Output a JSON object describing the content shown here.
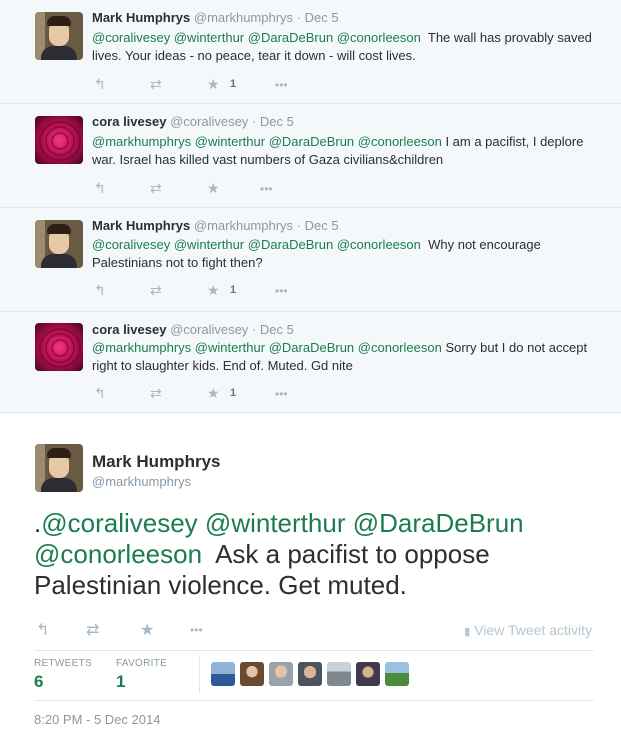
{
  "replies": [
    {
      "name": "Mark Humphrys",
      "screen_name": "@markhumphrys",
      "date": "Dec 5",
      "mentions": [
        "@coralivesey",
        "@winterthur",
        "@DaraDeBrun",
        "@conorleeson"
      ],
      "text": "The wall has provably saved lives. Your ideas - no peace, tear it down - will cost lives.",
      "favorite_count": "1",
      "avatar": "man-portrait"
    },
    {
      "name": "cora livesey",
      "screen_name": "@coralivesey",
      "date": "Dec 5",
      "mentions": [
        "@markhumphrys",
        "@winterthur",
        "@DaraDeBrun",
        "@conorleeson"
      ],
      "text": "I am a pacifist, I deplore war. Israel has killed vast numbers of Gaza civilians&children",
      "favorite_count": "",
      "avatar": "pink-rose"
    },
    {
      "name": "Mark Humphrys",
      "screen_name": "@markhumphrys",
      "date": "Dec 5",
      "mentions": [
        "@coralivesey",
        "@winterthur",
        "@DaraDeBrun",
        "@conorleeson"
      ],
      "text": "Why not encourage Palestinians not to fight then?",
      "favorite_count": "1",
      "avatar": "man-portrait"
    },
    {
      "name": "cora livesey",
      "screen_name": "@coralivesey",
      "date": "Dec 5",
      "mentions": [
        "@markhumphrys",
        "@winterthur",
        "@DaraDeBrun",
        "@conorleeson"
      ],
      "text": "Sorry but I do not accept right to slaughter kids. End of. Muted. Gd nite",
      "favorite_count": "1",
      "avatar": "pink-rose"
    }
  ],
  "main_tweet": {
    "name": "Mark Humphrys",
    "screen_name": "@markhumphrys",
    "prefix": ".",
    "mentions": [
      "@coralivesey",
      "@winterthur",
      "@DaraDeBrun",
      "@conorleeson"
    ],
    "text": "Ask a pacifist to oppose Palestinian violence. Get muted.",
    "view_activity": "View Tweet activity",
    "stats": {
      "retweets_label": "RETWEETS",
      "retweets": "6",
      "favorite_label": "FAVORITE",
      "favorites": "1"
    },
    "timestamp": "8:20 PM - 5 Dec 2014"
  },
  "icons": {
    "reply": "↰",
    "retweet": "⇄",
    "favorite": "★",
    "more": "•••",
    "activity": "▮"
  },
  "colors": {
    "mention": "#1b7d4f",
    "muted": "#8899a6",
    "reply_bg": "#f5f8fa"
  },
  "favoriter_avatars": [
    "flag-avatar",
    "woman-avatar",
    "man-avatar-1",
    "man-avatar-2",
    "building-avatar",
    "man-avatar-3",
    "landscape-avatar"
  ]
}
